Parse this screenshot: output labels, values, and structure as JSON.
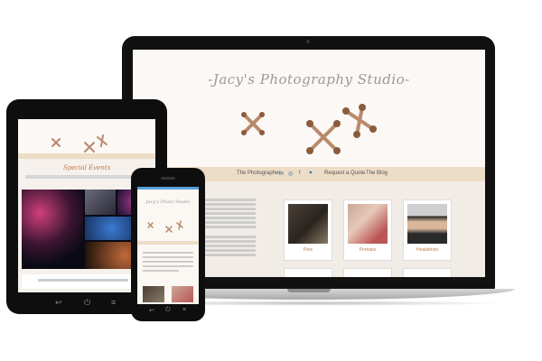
{
  "laptop": {
    "site_title": "-Jacy's Photography Studio-",
    "nav": {
      "photographer": "The Photographer",
      "request_quote": "Request a Quote",
      "blog": "The Blog"
    },
    "social_icons": [
      "email-icon",
      "instagram-icon",
      "facebook-icon",
      "twitter-icon"
    ],
    "galleries": [
      {
        "label": "Pets"
      },
      {
        "label": "Portraits"
      },
      {
        "label": "Headshots"
      }
    ]
  },
  "tablet": {
    "section_title": "Special Events"
  },
  "phone": {
    "site_title": "Jacy's Photo Studio"
  },
  "colors": {
    "nav_bg": "#eddcc6",
    "accent": "#c07a4a",
    "link": "#2a6fb0"
  }
}
